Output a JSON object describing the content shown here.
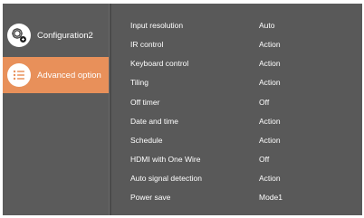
{
  "sidebar": {
    "items": [
      {
        "label": "Configuration2",
        "icon": "gear-icon"
      },
      {
        "label": "Advanced option",
        "icon": "list-icon"
      }
    ]
  },
  "settings": [
    {
      "name": "Input resolution",
      "value": "Auto"
    },
    {
      "name": "IR control",
      "value": "Action"
    },
    {
      "name": "Keyboard control",
      "value": "Action"
    },
    {
      "name": "Tiling",
      "value": "Action"
    },
    {
      "name": "Off timer",
      "value": "Off"
    },
    {
      "name": "Date and time",
      "value": "Action"
    },
    {
      "name": "Schedule",
      "value": "Action"
    },
    {
      "name": "HDMI with One Wire",
      "value": "Off"
    },
    {
      "name": "Auto signal detection",
      "value": "Action"
    },
    {
      "name": "Power save",
      "value": "Mode1"
    }
  ],
  "colors": {
    "background": "#595959",
    "selected": "#e8905a",
    "text": "#ffffff"
  }
}
